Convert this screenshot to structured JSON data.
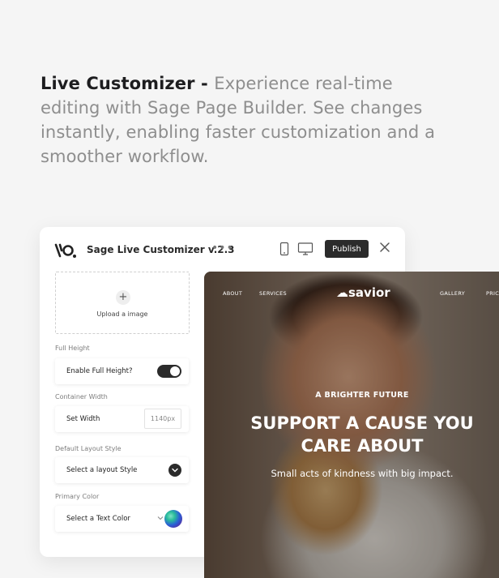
{
  "headline": {
    "strong": "Live Customizer - ",
    "rest": "Experience real-time editing with Sage Page Builder. See changes instantly, enabling faster customization and a smoother workflow."
  },
  "customizer": {
    "title": "Sage Live Customizer v.2.3",
    "more_icon": "ellipsis-icon",
    "device_icons": [
      "mobile-icon",
      "desktop-icon"
    ],
    "publish_label": "Publish",
    "close_icon": "close-icon",
    "upload_label": "Upload a image",
    "full_height": {
      "section": "Full Height",
      "label": "Enable Full Height?",
      "enabled": true
    },
    "container_width": {
      "section": "Container Width",
      "label": "Set Width",
      "value": "1140px"
    },
    "layout_style": {
      "section": "Default Layout Style",
      "label": "Select a layout Style"
    },
    "primary_color": {
      "section": "Primary Color",
      "label": "Select a Text Color"
    }
  },
  "preview": {
    "nav": [
      "ABOUT",
      "SERVICES",
      "GALLERY",
      "PRICI"
    ],
    "brand": "savior",
    "eyebrow": "A BRIGHTER FUTURE",
    "title_line1": "SUPPORT A CAUSE YOU",
    "title_line2": "CARE ABOUT",
    "subtitle": "Small acts of kindness with big impact."
  }
}
